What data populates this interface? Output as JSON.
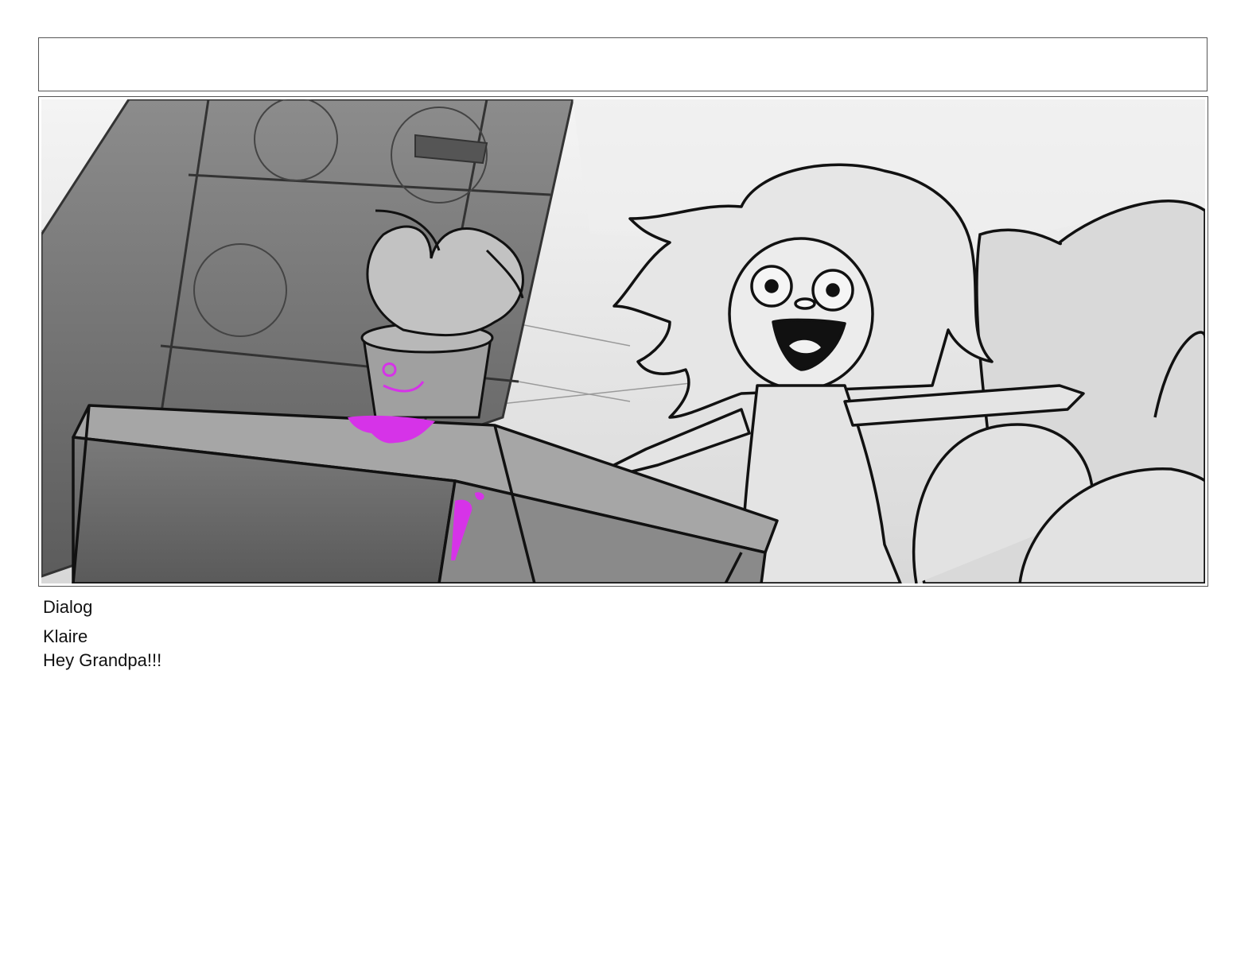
{
  "panel": {
    "header_text": "",
    "dialog_label": "Dialog",
    "speaker": "Klaire",
    "line": "Hey Grandpa!!!"
  },
  "artwork": {
    "style": "grayscale storyboard sketch",
    "accent_color": "#d633e8",
    "line_color": "#111111",
    "subjects": [
      "bookshelf",
      "potted-plant",
      "table",
      "girl",
      "couch"
    ]
  }
}
